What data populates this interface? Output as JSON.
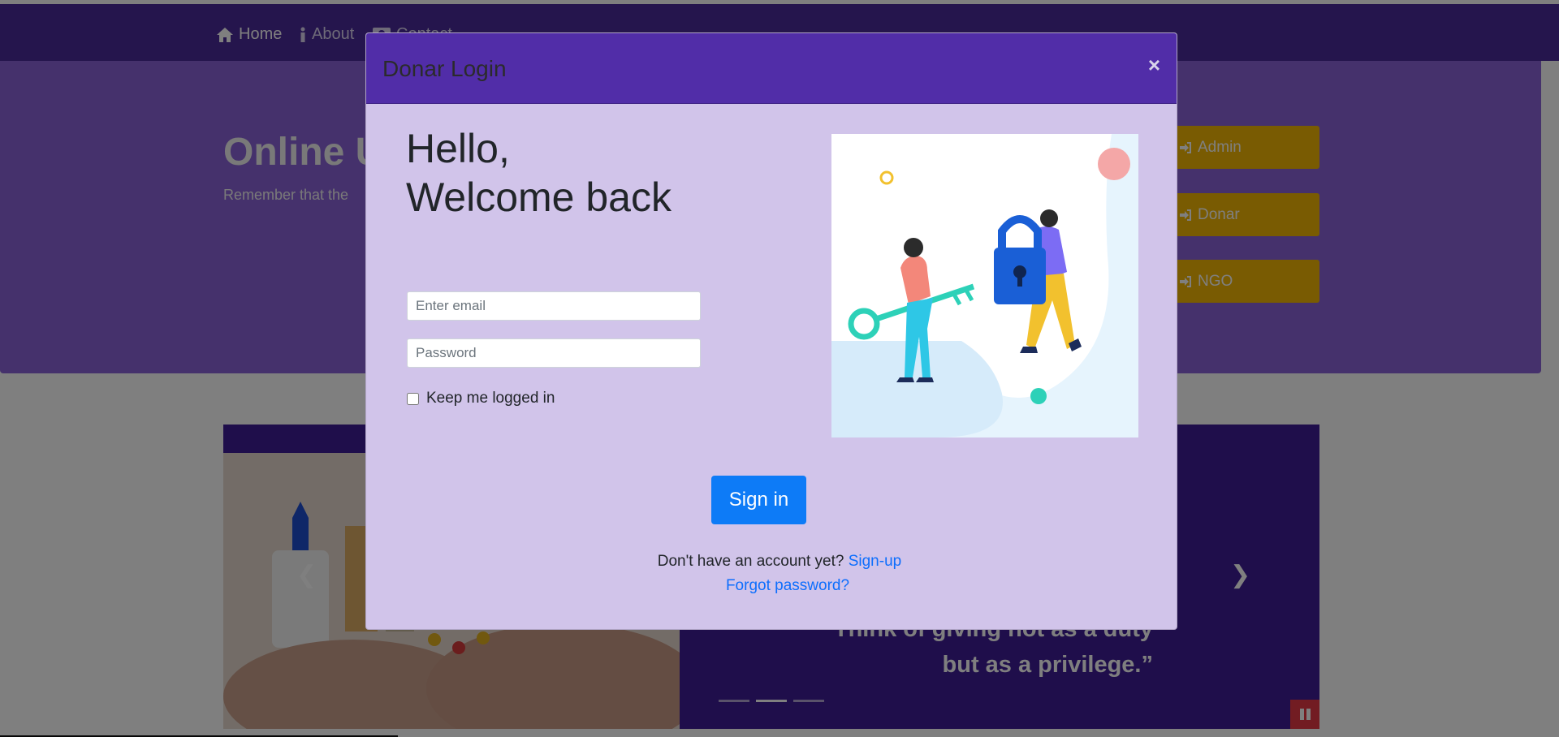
{
  "nav": {
    "home_label": "Home",
    "about_label": "About",
    "contact_label": "Contact"
  },
  "hero": {
    "title": "Online U",
    "subtitle": "Remember that the",
    "buttons": [
      {
        "label": "Admin",
        "icon": "sign-in-icon"
      },
      {
        "label": "Donar",
        "icon": "sign-in-icon"
      },
      {
        "label": "NGO",
        "icon": "sign-in-icon"
      }
    ]
  },
  "carousel": {
    "quote_line1": "Think of giving not as a duty",
    "quote_line2": "but as a privilege.”",
    "prev_icon": "chevron-left-icon",
    "next_icon": "chevron-right-icon",
    "pause_icon": "pause-icon"
  },
  "modal": {
    "title": "Donar Login",
    "close_symbol": "×",
    "greeting_line1": "Hello,",
    "greeting_line2": "Welcome back",
    "email_placeholder": "Enter email",
    "password_placeholder": "Password",
    "remember_label": "Keep me logged in",
    "signin_label": "Sign in",
    "no_account_text": "Don't have an account yet?",
    "signup_link": "Sign-up",
    "forgot_link": "Forgot password?"
  },
  "colors": {
    "navbar": "#4a2a9a",
    "modal_header": "#512da8",
    "modal_body": "#d1c4ea",
    "primary_button": "#0d7bf7",
    "role_button": "#f2b705",
    "link": "#0d6efd"
  }
}
